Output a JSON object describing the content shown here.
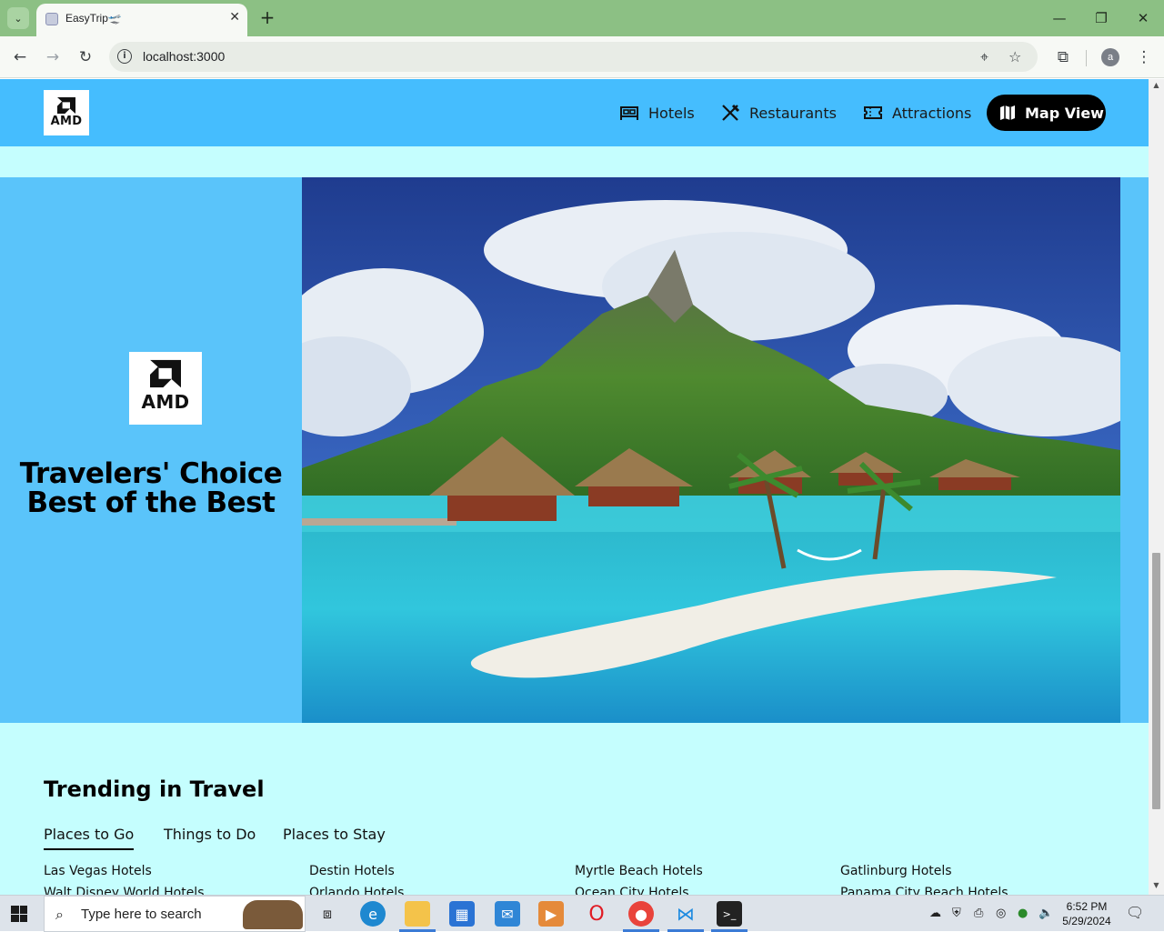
{
  "browser": {
    "tab_title": "EasyTrip",
    "tab_title_emoji": "🛫",
    "url": "localhost:3000",
    "new_tab_glyph": "+",
    "close_glyph": "✕"
  },
  "site": {
    "logo_text": "AMD",
    "nav": [
      {
        "label": "Hotels",
        "icon": "bed-icon"
      },
      {
        "label": "Restaurants",
        "icon": "utensils-icon"
      },
      {
        "label": "Attractions",
        "icon": "ticket-icon"
      }
    ],
    "map_button": "Map View",
    "header_color": "#45bdfe",
    "page_color": "#c5fefe"
  },
  "hero": {
    "title": "Travelers' Choice Best of the Best",
    "logo_text": "AMD",
    "image_alt": "Tropical island with overwater bungalows"
  },
  "trending": {
    "title": "Trending in Travel",
    "tabs": [
      "Places to Go",
      "Things to Do",
      "Places to Stay"
    ],
    "active_tab": "Places to Go",
    "links": [
      [
        "Las Vegas Hotels",
        "Walt Disney World Hotels"
      ],
      [
        "Destin Hotels",
        "Orlando Hotels"
      ],
      [
        "Myrtle Beach Hotels",
        "Ocean City Hotels"
      ],
      [
        "Gatlinburg Hotels",
        "Panama City Beach Hotels"
      ]
    ]
  },
  "taskbar": {
    "search_placeholder": "Type here to search",
    "time": "6:52 PM",
    "date": "5/29/2024"
  }
}
